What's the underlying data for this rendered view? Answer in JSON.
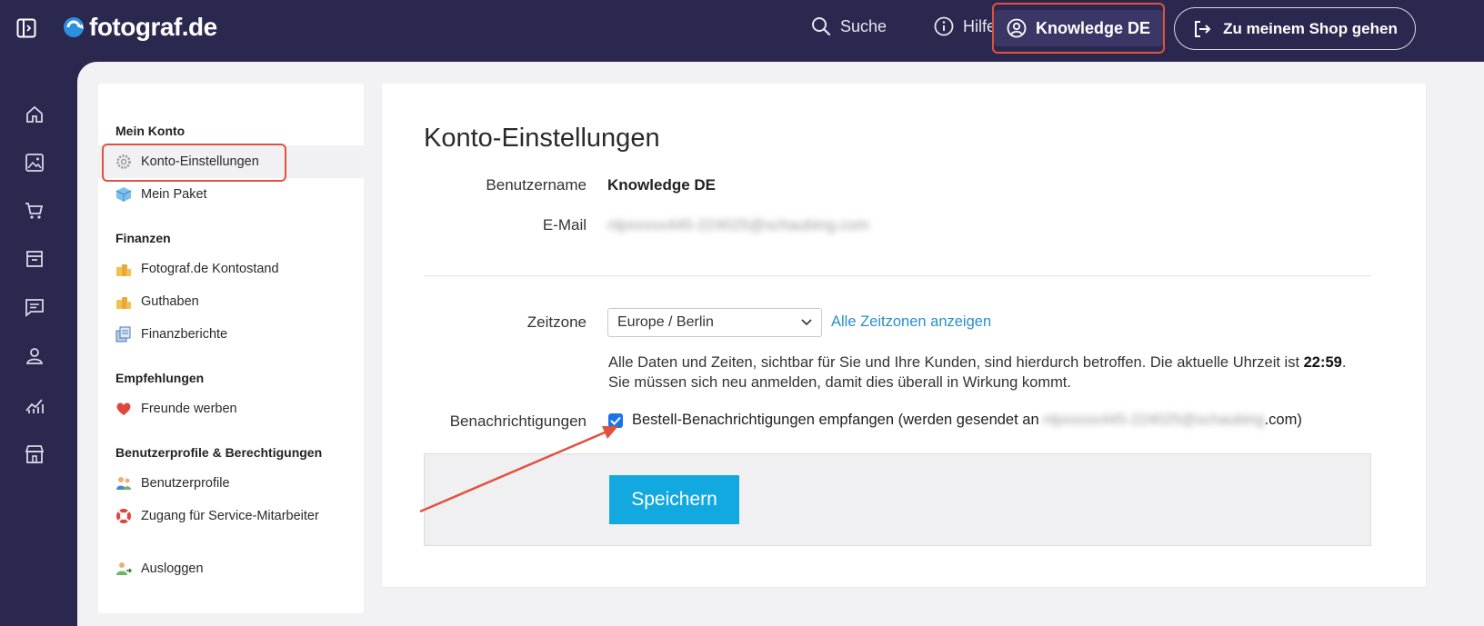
{
  "brand": {
    "name": "fotograf.de"
  },
  "topnav": {
    "search_label": "Suche",
    "help_label": "Hilfe",
    "account_label": "Knowledge DE",
    "shop_label": "Zu meinem Shop gehen"
  },
  "rail": {
    "icons": [
      "home-icon",
      "image-icon",
      "cart-icon",
      "archive-icon",
      "message-icon",
      "person-icon",
      "analytics-icon",
      "store-icon"
    ]
  },
  "subnav": {
    "sections": [
      {
        "title": "Mein Konto",
        "items": [
          "Konto-Einstellungen",
          "Mein Paket"
        ]
      },
      {
        "title": "Finanzen",
        "items": [
          "Fotograf.de Kontostand",
          "Guthaben",
          "Finanzberichte"
        ]
      },
      {
        "title": "Empfehlungen",
        "items": [
          "Freunde werben"
        ]
      },
      {
        "title": "Benutzerprofile & Berechtigungen",
        "items": [
          "Benutzerprofile",
          "Zugang für Service-Mitarbeiter"
        ]
      }
    ],
    "logout": "Ausloggen"
  },
  "settings": {
    "title": "Konto-Einstellungen",
    "username_label": "Benutzername",
    "username_value": "Knowledge DE",
    "email_label": "E-Mail",
    "email_value": "nlpxxxxx445-224025@schaubing.com",
    "timezone_label": "Zeitzone",
    "timezone_value": "Europe / Berlin",
    "timezone_link": "Alle Zeitzonen anzeigen",
    "timezone_note_prefix": "Alle Daten und Zeiten, sichtbar für Sie und Ihre Kunden, sind hierdurch betroffen. Die aktuelle Uhrzeit ist ",
    "current_time": "22:59",
    "timezone_note_suffix": ".",
    "timezone_note_line2": "Sie müssen sich neu anmelden, damit dies überall in Wirkung kommt.",
    "notifications_label": "Benachrichtigungen",
    "notifications_checked": true,
    "notifications_text_prefix": "Bestell-Benachrichtigungen empfangen (werden gesendet an ",
    "notifications_email_blurred": "nlpxxxxx445-224025@schaubing",
    "notifications_text_suffix": ".com)",
    "save_label": "Speichern"
  },
  "colors": {
    "header_bg": "#2b2850",
    "highlight": "#e0523f",
    "save_button": "#12a9e0",
    "link": "#2a8fc7",
    "checkbox": "#1a73e8"
  }
}
